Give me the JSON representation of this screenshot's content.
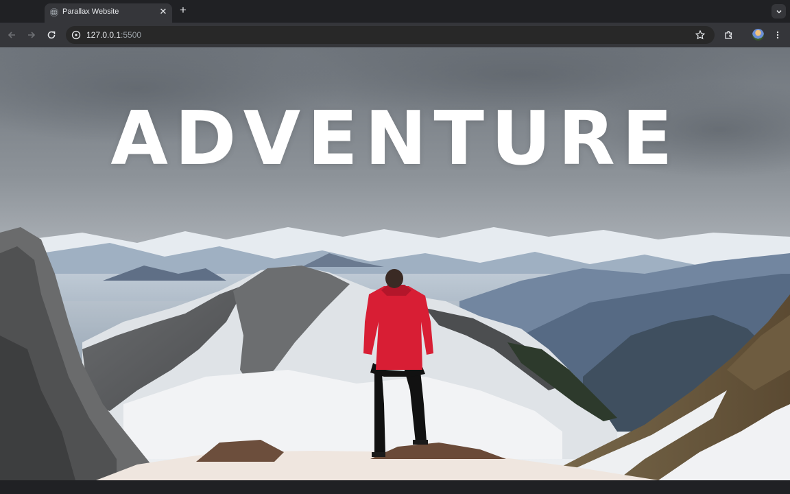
{
  "browser": {
    "tab": {
      "title": "Parallax Website",
      "favicon": "globe-icon",
      "close_icon": "close-icon"
    },
    "new_tab_icon": "plus-icon",
    "tab_search_icon": "chevron-down-icon",
    "toolbar": {
      "back_icon": "back-arrow-icon",
      "forward_icon": "forward-arrow-icon",
      "reload_icon": "reload-icon",
      "site_info_icon": "info-icon",
      "bookmark_icon": "star-icon",
      "extensions_icon": "puzzle-icon",
      "menu_icon": "kebab-menu-icon"
    },
    "address": {
      "host": "127.0.0.1",
      "port": ":5500"
    }
  },
  "page": {
    "headline": "ADVENTURE",
    "colors": {
      "sky_top": "#6f757c",
      "sky_bottom": "#e9ecef",
      "jacket": "#d81e34",
      "snow": "#f2f3f5"
    }
  }
}
